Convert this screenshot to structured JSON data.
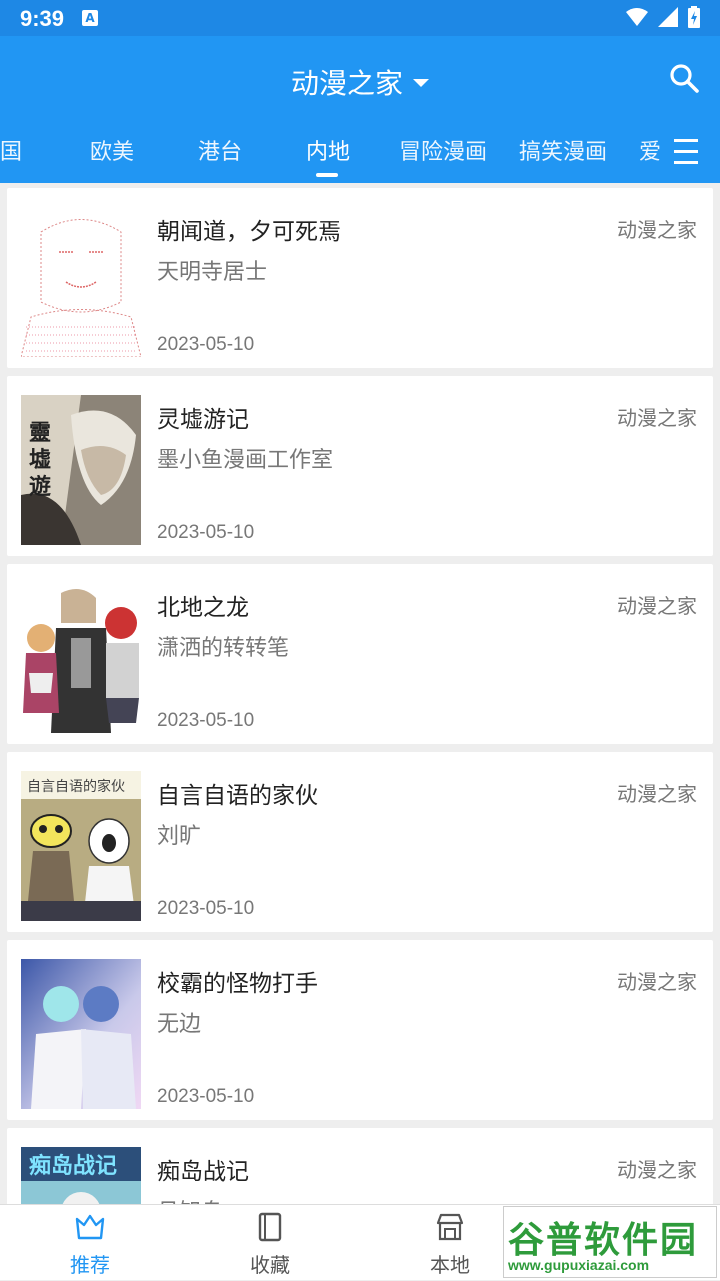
{
  "status_bar": {
    "time": "9:39",
    "notification_icon": "A"
  },
  "app_bar": {
    "title": "动漫之家"
  },
  "tabs": [
    {
      "label": "韩国"
    },
    {
      "label": "欧美"
    },
    {
      "label": "港台"
    },
    {
      "label": "内地",
      "active": true
    },
    {
      "label": "冒险漫画"
    },
    {
      "label": "搞笑漫画"
    },
    {
      "label": "爱"
    }
  ],
  "comics": [
    {
      "title": "朝闻道，夕可死焉",
      "author": "天明寺居士",
      "date": "2023-05-10",
      "source": "动漫之家"
    },
    {
      "title": "灵墟游记",
      "author": "墨小鱼漫画工作室",
      "date": "2023-05-10",
      "source": "动漫之家"
    },
    {
      "title": "北地之龙",
      "author": "潇洒的转转笔",
      "date": "2023-05-10",
      "source": "动漫之家"
    },
    {
      "title": "自言自语的家伙",
      "author": "刘旷",
      "date": "2023-05-10",
      "source": "动漫之家"
    },
    {
      "title": "校霸的怪物打手",
      "author": "无边",
      "date": "2023-05-10",
      "source": "动漫之家"
    },
    {
      "title": "痴岛战记",
      "author": "月知鸟",
      "date": "",
      "source": "动漫之家"
    }
  ],
  "bottom_nav": [
    {
      "label": "推荐",
      "icon": "crown-icon",
      "active": true
    },
    {
      "label": "收藏",
      "icon": "book-icon"
    },
    {
      "label": "本地",
      "icon": "store-icon"
    }
  ],
  "watermark": {
    "name": "谷普软件园",
    "url": "www.gupuxiazai.com"
  },
  "colors": {
    "primary": "#2196f3",
    "status_bar": "#1e88e5",
    "background": "#eeeeee"
  }
}
